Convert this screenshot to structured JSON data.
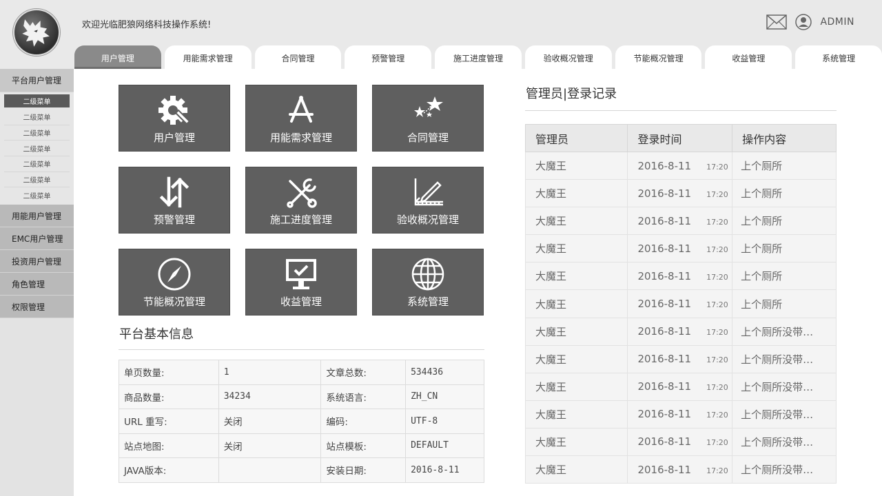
{
  "header": {
    "welcome": "欢迎光临肥狼网络科技操作系统!",
    "admin_name": "ADMIN"
  },
  "tabs": [
    {
      "label": "用户管理",
      "active": true
    },
    {
      "label": "用能需求管理"
    },
    {
      "label": "合同管理"
    },
    {
      "label": "预警管理"
    },
    {
      "label": "施工进度管理"
    },
    {
      "label": "验收概况管理"
    },
    {
      "label": "节能概况管理"
    },
    {
      "label": "收益管理"
    },
    {
      "label": "系统管理"
    }
  ],
  "sidebar": {
    "group_main": "平台用户管理",
    "sub_items": [
      "二级菜单",
      "二级菜单",
      "二级菜单",
      "二级菜单",
      "二级菜单",
      "二级菜单",
      "二级菜单"
    ],
    "groups": [
      "用能用户管理",
      "EMC用户管理",
      "投资用户管理",
      "角色管理",
      "权限管理"
    ]
  },
  "tiles": [
    {
      "label": "用户管理",
      "icon": "gear-wrench-icon"
    },
    {
      "label": "用能需求管理",
      "icon": "app-store-icon"
    },
    {
      "label": "合同管理",
      "icon": "stars-icon"
    },
    {
      "label": "预警管理",
      "icon": "up-down-arrows-icon"
    },
    {
      "label": "施工进度管理",
      "icon": "tools-icon"
    },
    {
      "label": "验收概况管理",
      "icon": "ruler-pencil-icon"
    },
    {
      "label": "节能概况管理",
      "icon": "compass-icon"
    },
    {
      "label": "收益管理",
      "icon": "monitor-check-icon"
    },
    {
      "label": "系统管理",
      "icon": "globe-icon"
    }
  ],
  "info": {
    "title": "平台基本信息",
    "rows": [
      [
        "单页数量:",
        "1",
        "文章总数:",
        "534436"
      ],
      [
        "商品数量:",
        "34234",
        "系统语言:",
        "ZH_CN"
      ],
      [
        "URL 重写:",
        "关闭",
        "编码:",
        "UTF-8"
      ],
      [
        "站点地图:",
        "关闭",
        "站点模板:",
        "DEFAULT"
      ],
      [
        "JAVA版本:",
        "",
        "安装日期:",
        "2016-8-11"
      ]
    ]
  },
  "log": {
    "title": "管理员|登录记录",
    "headers": [
      "管理员",
      "登录时间",
      "操作内容"
    ],
    "rows": [
      {
        "admin": "大魔王",
        "date": "2016-8-11",
        "time": "17:20",
        "content": "上个厕所"
      },
      {
        "admin": "大魔王",
        "date": "2016-8-11",
        "time": "17:20",
        "content": "上个厕所"
      },
      {
        "admin": "大魔王",
        "date": "2016-8-11",
        "time": "17:20",
        "content": "上个厕所"
      },
      {
        "admin": "大魔王",
        "date": "2016-8-11",
        "time": "17:20",
        "content": "上个厕所"
      },
      {
        "admin": "大魔王",
        "date": "2016-8-11",
        "time": "17:20",
        "content": "上个厕所"
      },
      {
        "admin": "大魔王",
        "date": "2016-8-11",
        "time": "17:20",
        "content": "上个厕所"
      },
      {
        "admin": "大魔王",
        "date": "2016-8-11",
        "time": "17:20",
        "content": "上个厕所没带…"
      },
      {
        "admin": "大魔王",
        "date": "2016-8-11",
        "time": "17:20",
        "content": "上个厕所没带…"
      },
      {
        "admin": "大魔王",
        "date": "2016-8-11",
        "time": "17:20",
        "content": "上个厕所没带…"
      },
      {
        "admin": "大魔王",
        "date": "2016-8-11",
        "time": "17:20",
        "content": "上个厕所没带…"
      },
      {
        "admin": "大魔王",
        "date": "2016-8-11",
        "time": "17:20",
        "content": "上个厕所没带…"
      },
      {
        "admin": "大魔王",
        "date": "2016-8-11",
        "time": "17:20",
        "content": "上个厕所没带…"
      }
    ]
  }
}
